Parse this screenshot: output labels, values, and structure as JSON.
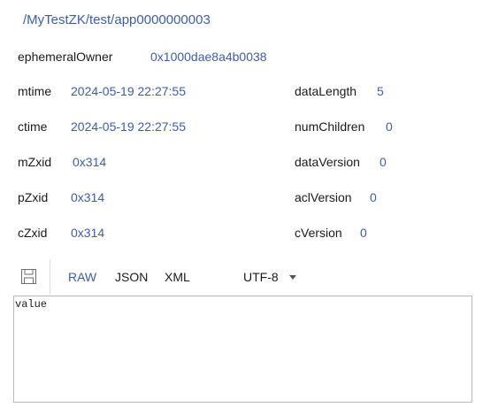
{
  "node_path": "/MyTestZK/test/app0000000003",
  "ephemeral_owner": {
    "label": "ephemeralOwner",
    "value": "0x1000dae8a4b0038"
  },
  "stats_left": [
    {
      "label": "mtime",
      "value": "2024-05-19 22:27:55"
    },
    {
      "label": "ctime",
      "value": "2024-05-19 22:27:55"
    },
    {
      "label": "mZxid",
      "value": "0x314"
    },
    {
      "label": "pZxid",
      "value": "0x314"
    },
    {
      "label": "cZxid",
      "value": "0x314"
    }
  ],
  "stats_right": [
    {
      "label": "dataLength",
      "value": "5"
    },
    {
      "label": "numChildren",
      "value": "0"
    },
    {
      "label": "dataVersion",
      "value": "0"
    },
    {
      "label": "aclVersion",
      "value": "0"
    },
    {
      "label": "cVersion",
      "value": "0"
    }
  ],
  "toolbar": {
    "save_icon": "save-icon",
    "formats": [
      "RAW",
      "JSON",
      "XML"
    ],
    "active_format": "RAW",
    "encoding": "UTF-8"
  },
  "editor": {
    "content": "value"
  },
  "colors": {
    "accent": "#3d5cae",
    "text": "#1a1a1a",
    "border": "#b9b9b9"
  }
}
